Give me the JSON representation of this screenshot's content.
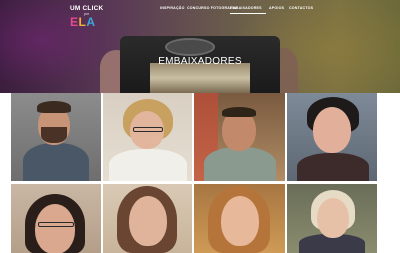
{
  "logo": {
    "line1": "UM CLICK",
    "line2": "por",
    "ela": [
      "E",
      "L",
      "A"
    ]
  },
  "nav": {
    "items": [
      {
        "label": "INSPIRAÇÃO",
        "active": false
      },
      {
        "label": "CONCURSO FOTOGRAFIA",
        "active": false
      },
      {
        "label": "EMBAIXADORES",
        "active": true
      },
      {
        "label": "APOIOS",
        "active": false
      },
      {
        "label": "CONTACTOS",
        "active": false
      }
    ]
  },
  "hero": {
    "title": "EMBAIXADORES"
  },
  "colors": {
    "ela_e": "#e34a8f",
    "ela_l": "#f2b134",
    "ela_a": "#3aa8d8"
  }
}
